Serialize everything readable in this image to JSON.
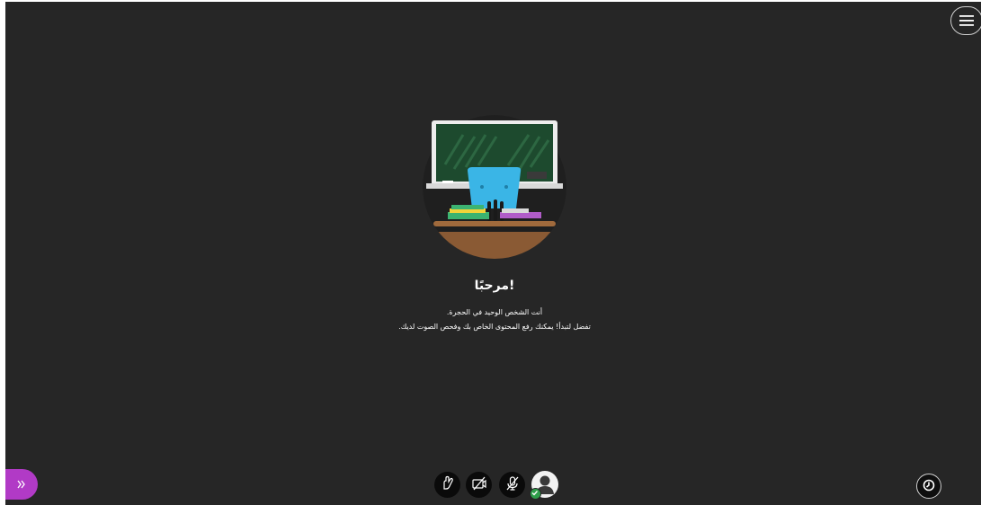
{
  "welcome": {
    "title": "مرحبًا!",
    "line1": "أنت الشخص الوحيد في الحجرة.",
    "line2": "تفضل لتبدأ! يمكنك رفع المحتوى الخاص بك وفحص الصوت لديك."
  },
  "icons": {
    "menu": "hamburger-menu-icon",
    "collaborate_panel": "double-chevron-right-icon",
    "hand": "raise-hand-icon",
    "camera": "camera-off-icon",
    "microphone": "microphone-off-icon",
    "avatar": "user-avatar-icon",
    "status": "checkmark-icon",
    "session": "session-menu-icon"
  },
  "colors": {
    "background": "#262626",
    "collaborate_panel_accent": "#b13ac6",
    "status_green": "#2e9e4a"
  }
}
